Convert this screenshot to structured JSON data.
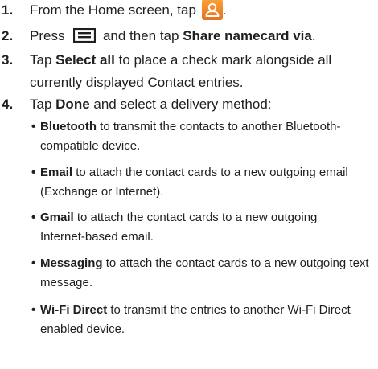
{
  "steps": [
    {
      "number": "1.",
      "text_before": "From the Home screen, tap",
      "icon": "contacts-icon",
      "text_after": "."
    },
    {
      "number": "2.",
      "text_before": "Press",
      "icon": "menu-icon",
      "text_middle": "and then tap",
      "bold": "Share namecard via",
      "text_after": "."
    },
    {
      "number": "3.",
      "text_before": "Tap",
      "bold": "Select all",
      "line1_rest": "to place a check mark alongside all",
      "line2": "currently displayed Contact entries."
    },
    {
      "number": "4.",
      "text_before": "Tap",
      "bold": "Done",
      "text_after": "and select a delivery method:"
    }
  ],
  "delivery_methods": [
    {
      "name": "Bluetooth",
      "line1": "to transmit the contacts to another Bluetooth-",
      "line2": "compatible device."
    },
    {
      "name": "Email",
      "line1": "to attach the contact cards to a new outgoing email",
      "line2": "(Exchange or Internet)."
    },
    {
      "name": "Gmail",
      "line1": "to attach the contact cards to a new outgoing",
      "line2": "Internet-based email."
    },
    {
      "name": "Messaging",
      "line1": "to attach the contact cards to a new outgoing text",
      "line2": "message."
    },
    {
      "name": "Wi-Fi Direct",
      "line1": "to transmit the entries to another Wi-Fi Direct",
      "line2": "enabled device."
    }
  ],
  "bullet_char": "•",
  "colors": {
    "text": "#1f1f1f",
    "contacts_icon": "#f08a2a"
  }
}
